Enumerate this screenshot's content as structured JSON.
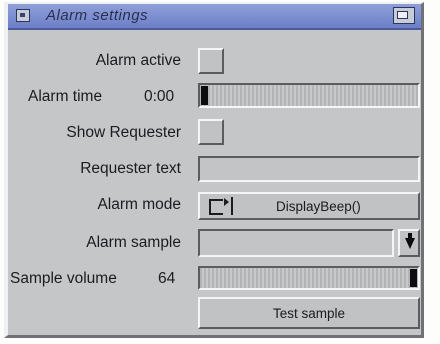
{
  "window": {
    "title": "Alarm settings"
  },
  "fields": {
    "alarm_active_label": "Alarm active",
    "alarm_time_label": "Alarm time",
    "alarm_time_value": "0:00",
    "alarm_time_level": 0,
    "show_requester_label": "Show Requester",
    "requester_text_label": "Requester text",
    "requester_text_value": "",
    "alarm_mode_label": "Alarm mode",
    "alarm_mode_value": "DisplayBeep()",
    "alarm_sample_label": "Alarm sample",
    "alarm_sample_value": "",
    "sample_volume_label": "Sample volume",
    "sample_volume_value": "64",
    "sample_volume_level": 1.0,
    "test_sample_label": "Test sample"
  },
  "icons": {
    "close": "close-icon",
    "depth": "depth-icon",
    "cycle": "cycle-icon",
    "popup": "chevron-down-icon"
  },
  "colors": {
    "titlebar": "#7a8cd0",
    "panel": "#c4c6c8",
    "knob": "#0c0c10"
  }
}
